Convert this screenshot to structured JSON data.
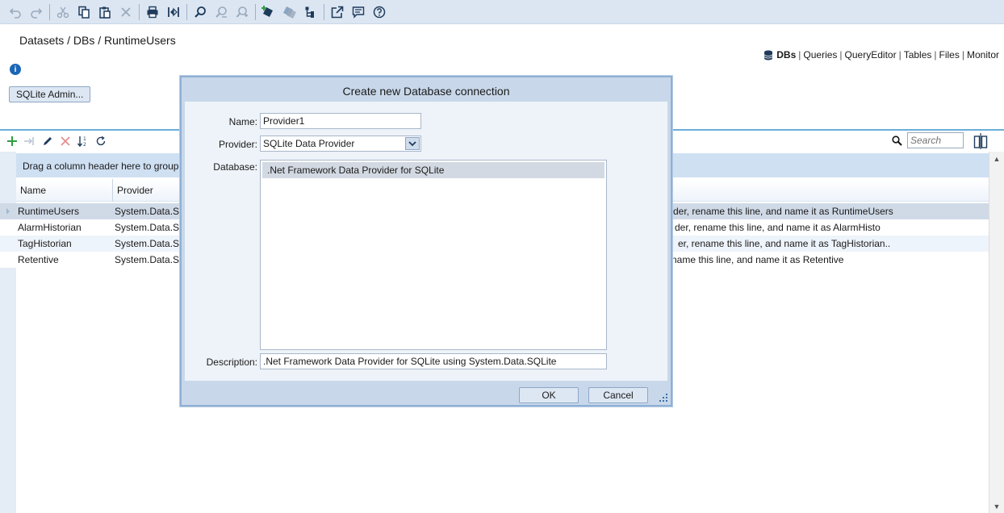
{
  "toolbar": {
    "icons": [
      "undo-icon",
      "redo-icon",
      "cut-icon",
      "copy-icon",
      "paste-icon",
      "delete-icon",
      "print-icon",
      "compare-icon",
      "find-icon",
      "find-user-icon",
      "find-user-next-icon",
      "add-shield-icon",
      "tags-icon",
      "tree-icon",
      "open-external-icon",
      "comment-icon",
      "help-icon"
    ]
  },
  "breadcrumb": "Datasets / DBs / RuntimeUsers",
  "nav": {
    "items": [
      "DBs",
      "Queries",
      "QueryEditor",
      "Tables",
      "Files",
      "Monitor"
    ],
    "separator": "|",
    "active": "DBs"
  },
  "info_glyph": "i",
  "admin_button": "SQLite Admin...",
  "search": {
    "placeholder": "Search"
  },
  "grid": {
    "group_panel_text": "Drag a column header here to group",
    "columns": [
      "Name",
      "Provider"
    ],
    "rows": [
      {
        "name": "RuntimeUsers",
        "provider": "System.Data.S...",
        "description": "der, rename this line, and name it as RuntimeUsers"
      },
      {
        "name": "AlarmHistorian",
        "provider": "System.Data.S...",
        "description": "der, rename this line, and name it as AlarmHisto"
      },
      {
        "name": "TagHistorian",
        "provider": "System.Data.S...",
        "description": "er, rename this line, and name it as TagHistorian.."
      },
      {
        "name": "Retentive",
        "provider": "System.Data.S...",
        "description": "name this line, and name it as Retentive"
      }
    ]
  },
  "dialog": {
    "title": "Create new Database connection",
    "name_label": "Name:",
    "name_value": "Provider1",
    "provider_label": "Provider:",
    "provider_value": "SQLite Data Provider",
    "database_label": "Database:",
    "database_items": [
      ".Net Framework Data Provider for SQLite"
    ],
    "description_label": "Description:",
    "description_value": ".Net Framework Data Provider for SQLite using System.Data.SQLite",
    "ok_label": "OK",
    "cancel_label": "Cancel"
  },
  "colors": {
    "toolbar_bg": "#dce6f2",
    "accent_line": "#6aaed8",
    "dialog_frame": "#c8d8ea",
    "add_green": "#2e9e3e",
    "delete_red": "#d64545",
    "icon_dark": "#1f3b5c"
  }
}
